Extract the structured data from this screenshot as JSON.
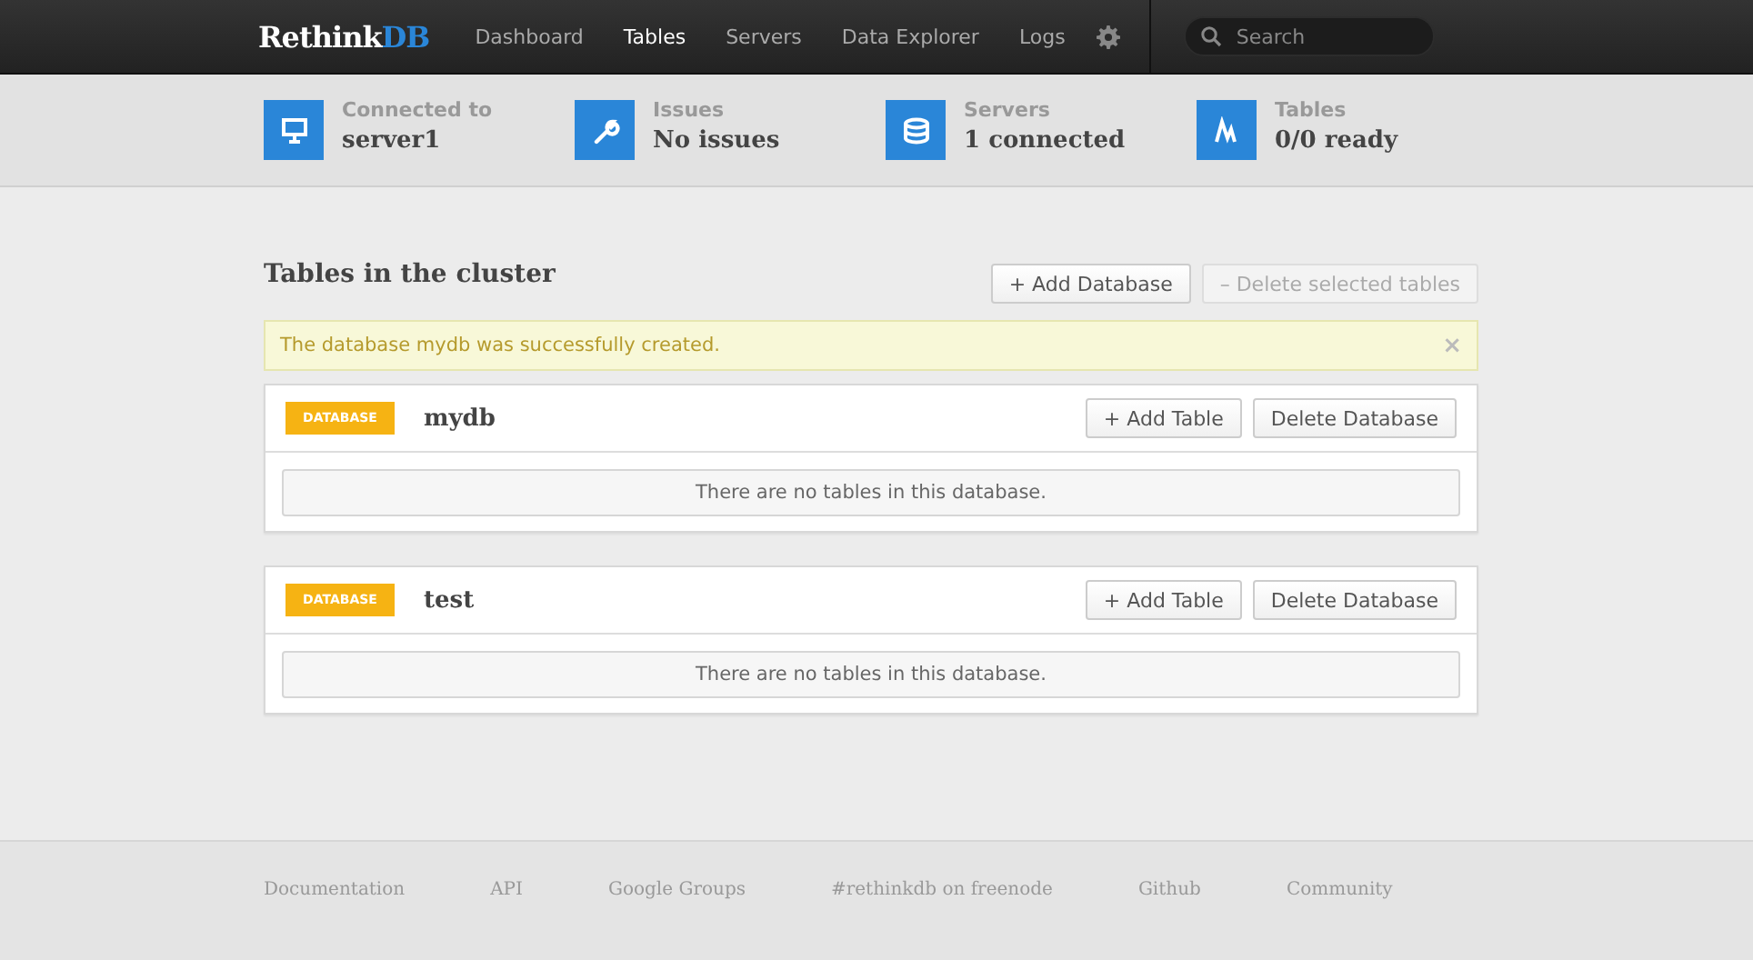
{
  "logo": {
    "text": "Rethink",
    "accent": "DB"
  },
  "nav": [
    {
      "label": "Dashboard",
      "selected": false
    },
    {
      "label": "Tables",
      "selected": true
    },
    {
      "label": "Servers",
      "selected": false
    },
    {
      "label": "Data Explorer",
      "selected": false
    },
    {
      "label": "Logs",
      "selected": false
    }
  ],
  "search": {
    "placeholder": "Search"
  },
  "stats": [
    {
      "kind": "monitor",
      "label": "Connected to",
      "value": "server1"
    },
    {
      "kind": "wrench",
      "label": "Issues",
      "value": "No issues"
    },
    {
      "kind": "database",
      "label": "Servers",
      "value": "1 connected"
    },
    {
      "kind": "pulse",
      "label": "Tables",
      "value": "0/0 ready"
    }
  ],
  "page_title": "Tables in the cluster",
  "actions": [
    {
      "label": "+ Add Database",
      "disabled": false
    },
    {
      "label": "– Delete selected tables",
      "disabled": true
    }
  ],
  "alert": {
    "message": "The database mydb was successfully created.",
    "close": "×"
  },
  "databases": [
    {
      "badge": "DATABASE",
      "name": "mydb",
      "buttons": [
        "+ Add Table",
        "Delete Database"
      ],
      "empty": "There are no tables in this database."
    },
    {
      "badge": "DATABASE",
      "name": "test",
      "buttons": [
        "+ Add Table",
        "Delete Database"
      ],
      "empty": "There are no tables in this database."
    }
  ],
  "footer": [
    "Documentation",
    "API",
    "Google Groups",
    "#rethinkdb on freenode",
    "Github",
    "Community"
  ]
}
